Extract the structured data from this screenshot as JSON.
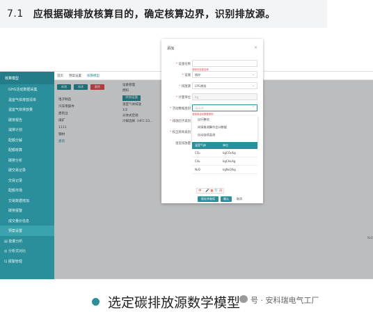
{
  "heading": {
    "number": "7.1",
    "text": "应根据碳排放核算目的，确定核算边界，识别排放源。"
  },
  "sidebar": {
    "title": "核算模型",
    "items": [
      "GHG活动数据采集",
      "温室气体排放清单",
      "温室气体排放量",
      "碳排报告",
      "减排计划",
      "配额分解",
      "配额核算",
      "碳排分析",
      "碳交易记录",
      "交易记录",
      "配额市场",
      "交易数据增加",
      "碳排报警",
      "成交量价信息",
      "预案设置"
    ],
    "groups": [
      "能量分析",
      "分析式对比",
      "报警管理"
    ]
  },
  "topbar": {
    "tabs": [
      "首页",
      "预案设置",
      "核算模型"
    ]
  },
  "toolbar": {
    "buttons": [
      "新增",
      "修改",
      "删除"
    ],
    "colors": [
      "#2a8f9a",
      "#2a8f9a",
      "#e25050"
    ]
  },
  "tree": {
    "items": [
      "电子制造",
      "汽车零部件",
      "建筑业",
      "煤矿",
      "1111",
      "钢材",
      "建筑"
    ]
  },
  "right_pane": {
    "lines": [
      "设备管理",
      "燃料",
      "添加设施",
      "温室气体排放",
      "1/2",
      "分体式空调",
      "冷媒选择（HFC-23..."
    ],
    "button": "添加设施"
  },
  "modal": {
    "title": "添加",
    "close": "×",
    "fields": [
      {
        "label": "设施名称",
        "value": "",
        "error": "请填写设施名称"
      },
      {
        "label": "设施",
        "value": "锅炉"
      },
      {
        "label": "排放源",
        "value": "LPG燃烧"
      },
      {
        "label": "计量单位",
        "value": "kg"
      },
      {
        "label": "活动数据类别",
        "value": "请选择",
        "error": "请选择活动数据类别"
      },
      {
        "label": "排放因子类别",
        "value": ""
      },
      {
        "label": "校正频率类别",
        "value": ""
      },
      {
        "label": "温室排放量",
        "value": ""
      }
    ],
    "dropdown": [
      "自行整估",
      "间接推测算作会计数据",
      "自动连续监测"
    ],
    "gas_table": {
      "headers": [
        "温室气体",
        "单位"
      ],
      "rows": [
        [
          "CO₂",
          "kgCO₂/kg"
        ],
        [
          "CH₄",
          "kgCH₄/kg"
        ],
        [
          "N₂O",
          "kgN₂O/kg"
        ]
      ]
    },
    "ime": "中 ·, 🎤 ▦ 👕 AI",
    "buttons": [
      "保存并继续",
      "确认",
      "取消"
    ]
  },
  "edge_label": "N₂O",
  "caption": "选定碳排放源数学模型",
  "watermark": "号 · 安科瑞电气工厂",
  "accent": "#2a8f9a"
}
